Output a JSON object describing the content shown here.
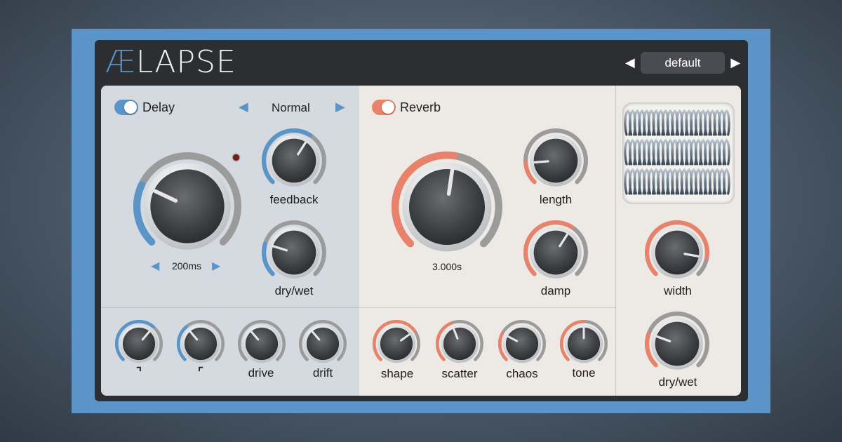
{
  "app": {
    "logo_ae": "Æ",
    "logo_rest": "LAPSE"
  },
  "preset": {
    "prev_glyph": "◀",
    "name": "default",
    "next_glyph": "▶"
  },
  "colors": {
    "delay_accent": "#5b94c6",
    "reverb_accent": "#e8826a",
    "neutral_track": "#9a9a9a"
  },
  "delay": {
    "label": "Delay",
    "enabled": true,
    "mode": {
      "prev_glyph": "◀",
      "value": "Normal",
      "next_glyph": "▶"
    },
    "time": {
      "value": "200ms",
      "prev_glyph": "◀",
      "next_glyph": "▶",
      "level": 0.26
    },
    "feedback": {
      "label": "feedback",
      "level": 0.62
    },
    "drywet": {
      "label": "dry/wet",
      "level": 0.23
    },
    "low_cut": {
      "label": "⌐",
      "level": 0.65
    },
    "high_cut": {
      "label": "⌐",
      "level": 0.35
    },
    "drive": {
      "label": "drive",
      "level": 0.35
    },
    "drift": {
      "label": "drift",
      "level": 0.35
    }
  },
  "reverb": {
    "label": "Reverb",
    "enabled": true,
    "size": {
      "value": "3.000s",
      "level": 0.53
    },
    "length": {
      "label": "length",
      "level": 0.15
    },
    "damp": {
      "label": "damp",
      "level": 0.62
    },
    "shape": {
      "label": "shape",
      "level": 0.7
    },
    "scatter": {
      "label": "scatter",
      "level": 0.42
    },
    "chaos": {
      "label": "chaos",
      "level": 0.27
    },
    "tone": {
      "label": "tone",
      "level": 0.5
    }
  },
  "output": {
    "width": {
      "label": "width",
      "level": 0.87
    },
    "drywet": {
      "label": "dry/wet",
      "level": 0.24
    }
  }
}
